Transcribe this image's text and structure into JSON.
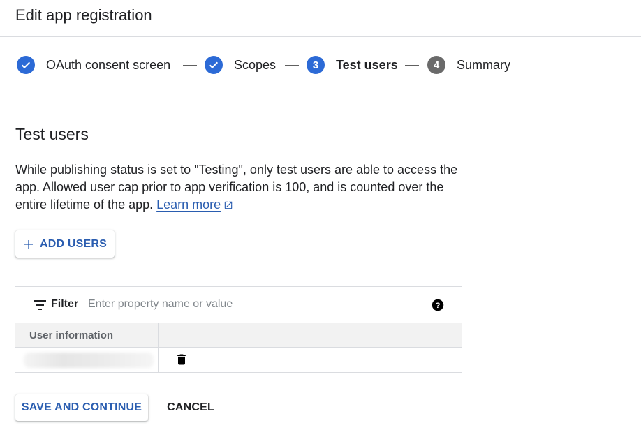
{
  "header": {
    "title": "Edit app registration"
  },
  "stepper": {
    "steps": [
      {
        "label": "OAuth consent screen",
        "state": "done",
        "icon": "check-icon"
      },
      {
        "label": "Scopes",
        "state": "done",
        "icon": "check-icon"
      },
      {
        "label": "Test users",
        "state": "active",
        "number": "3"
      },
      {
        "label": "Summary",
        "state": "pending",
        "number": "4"
      }
    ]
  },
  "section": {
    "title": "Test users",
    "description": "While publishing status is set to \"Testing\", only test users are able to access the app. Allowed user cap prior to app verification is 100, and is counted over the entire lifetime of the app. ",
    "learn_more": "Learn more"
  },
  "actions": {
    "add_users": "ADD USERS"
  },
  "filter": {
    "label": "Filter",
    "placeholder": "Enter property name or value"
  },
  "table": {
    "columns": [
      "User information",
      ""
    ],
    "rows": [
      {
        "user": "(redacted)",
        "action_icon": "delete-icon"
      }
    ]
  },
  "footer": {
    "save": "SAVE AND CONTINUE",
    "cancel": "CANCEL"
  },
  "colors": {
    "accent": "#2c6ad6",
    "link": "#2a5db0",
    "pending": "#6a6a6a"
  }
}
